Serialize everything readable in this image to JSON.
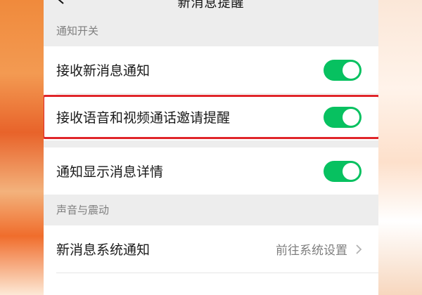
{
  "topbar": {
    "title": "新消息提醒",
    "back_icon": "chevron-left-icon"
  },
  "notification_switch": {
    "header": "通知开关",
    "items": [
      {
        "label": "接收新消息通知",
        "enabled": true
      },
      {
        "label": "接收语音和视频通话邀请提醒",
        "enabled": true,
        "highlighted": true
      },
      {
        "label": "通知显示消息详情",
        "enabled": true
      }
    ]
  },
  "sound_vibration": {
    "header": "声音与震动",
    "items": [
      {
        "label": "新消息系统通知",
        "value": "前往系统设置",
        "icon": "chevron-right-icon"
      }
    ]
  },
  "colors": {
    "toggle_on": "#07c160",
    "highlight": "#e0262a",
    "background": "#ededed"
  }
}
